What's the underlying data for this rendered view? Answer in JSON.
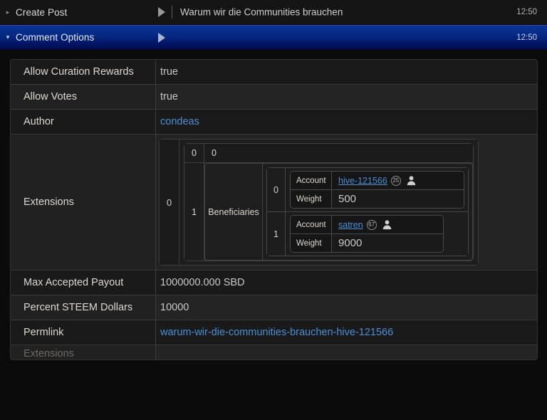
{
  "operations": [
    {
      "title": "Create Post",
      "caret": "collapsed-caret-right",
      "subtitle": "Warum wir die Communities brauchen",
      "time": "12:50",
      "state": "collapsed"
    },
    {
      "title": "Comment Options",
      "caret": "expanded-caret-down",
      "subtitle": "",
      "time": "12:50",
      "state": "expanded"
    }
  ],
  "details": {
    "rows": [
      {
        "key": "Allow Curation Rewards",
        "value": "true",
        "type": "text"
      },
      {
        "key": "Allow Votes",
        "value": "true",
        "type": "text"
      },
      {
        "key": "Author",
        "value": "condeas",
        "type": "link"
      },
      {
        "key": "Extensions",
        "value": "",
        "type": "extensions"
      },
      {
        "key": "Max Accepted Payout",
        "value": "1000000.000 SBD",
        "type": "text"
      },
      {
        "key": "Percent STEEM Dollars",
        "value": "10000",
        "type": "text"
      },
      {
        "key": "Permlink",
        "value": "warum-wir-die-communities-brauchen-hive-121566",
        "type": "link"
      },
      {
        "key": "Extensions",
        "value": "",
        "type": "clipped"
      }
    ],
    "extensions": {
      "outer_index": "0",
      "inner": [
        {
          "index": "0",
          "label": "0",
          "kind": "scalar"
        },
        {
          "index": "1",
          "label": "Beneficiaries",
          "kind": "list",
          "items": [
            {
              "index": "0",
              "account_caption": "Account",
              "account": "hive-121566",
              "reputation": "25",
              "weight_caption": "Weight",
              "weight": "500"
            },
            {
              "index": "1",
              "account_caption": "Account",
              "account": "satren",
              "reputation": "67",
              "weight_caption": "Weight",
              "weight": "9000"
            }
          ]
        }
      ]
    }
  },
  "colors": {
    "link": "#4c8fd6",
    "accent_blue": "#0a3394",
    "panel_bg": "#1c1c1c",
    "page_bg": "#0b0b0b"
  }
}
